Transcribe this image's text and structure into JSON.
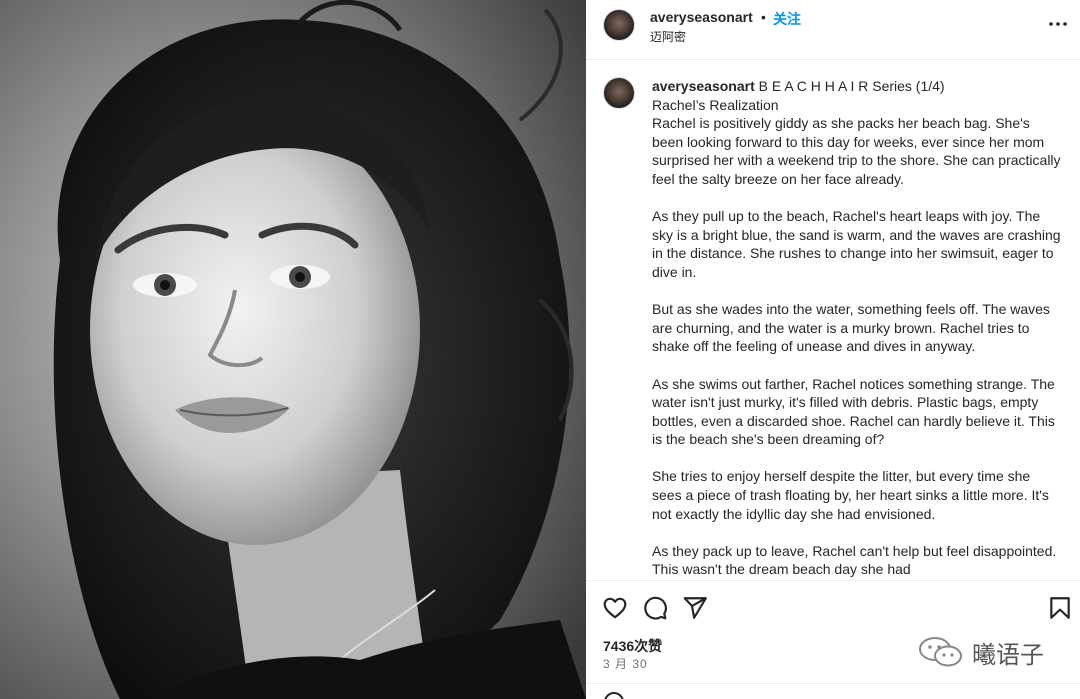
{
  "post": {
    "username": "averyseasonart",
    "separator": "•",
    "follow_label": "关注",
    "location": "迈阿密",
    "more_icon": "more-horizontal-icon"
  },
  "caption": {
    "username": "averyseasonart",
    "first_line": " B E A C H H A I R Series (1/4)\nRachel’s Realization\nRachel is positively giddy as she packs her beach bag. She's been looking forward to this day for weeks, ever since her mom surprised her with a weekend trip to the shore. She can practically feel the salty breeze on her face already.",
    "paragraphs": [
      "As they pull up to the beach, Rachel's heart leaps with joy. The sky is a bright blue, the sand is warm, and the waves are crashing in the distance. She rushes to change into her swimsuit, eager to dive in.",
      "But as she wades into the water, something feels off. The waves are churning, and the water is a murky brown. Rachel tries to shake off the feeling of unease and dives in anyway.",
      "As she swims out farther, Rachel notices something strange. The water isn't just murky, it's filled with debris. Plastic bags, empty bottles, even a discarded shoe. Rachel can hardly believe it. This is the beach she's been dreaming of?",
      "She tries to enjoy herself despite the litter, but every time she sees a piece of trash floating by, her heart sinks a little more. It's not exactly the idyllic day she had envisioned.",
      "As they pack up to leave, Rachel can't help but feel disappointed. This wasn't the dream beach day she had"
    ]
  },
  "actions": {
    "like_icon": "heart-icon",
    "comment_icon": "comment-icon",
    "share_icon": "share-icon",
    "save_icon": "bookmark-icon"
  },
  "stats": {
    "likes": "7436次赞",
    "date": "3 月 30"
  },
  "watermark": {
    "text": "曦语子",
    "icon": "wechat-icon"
  }
}
